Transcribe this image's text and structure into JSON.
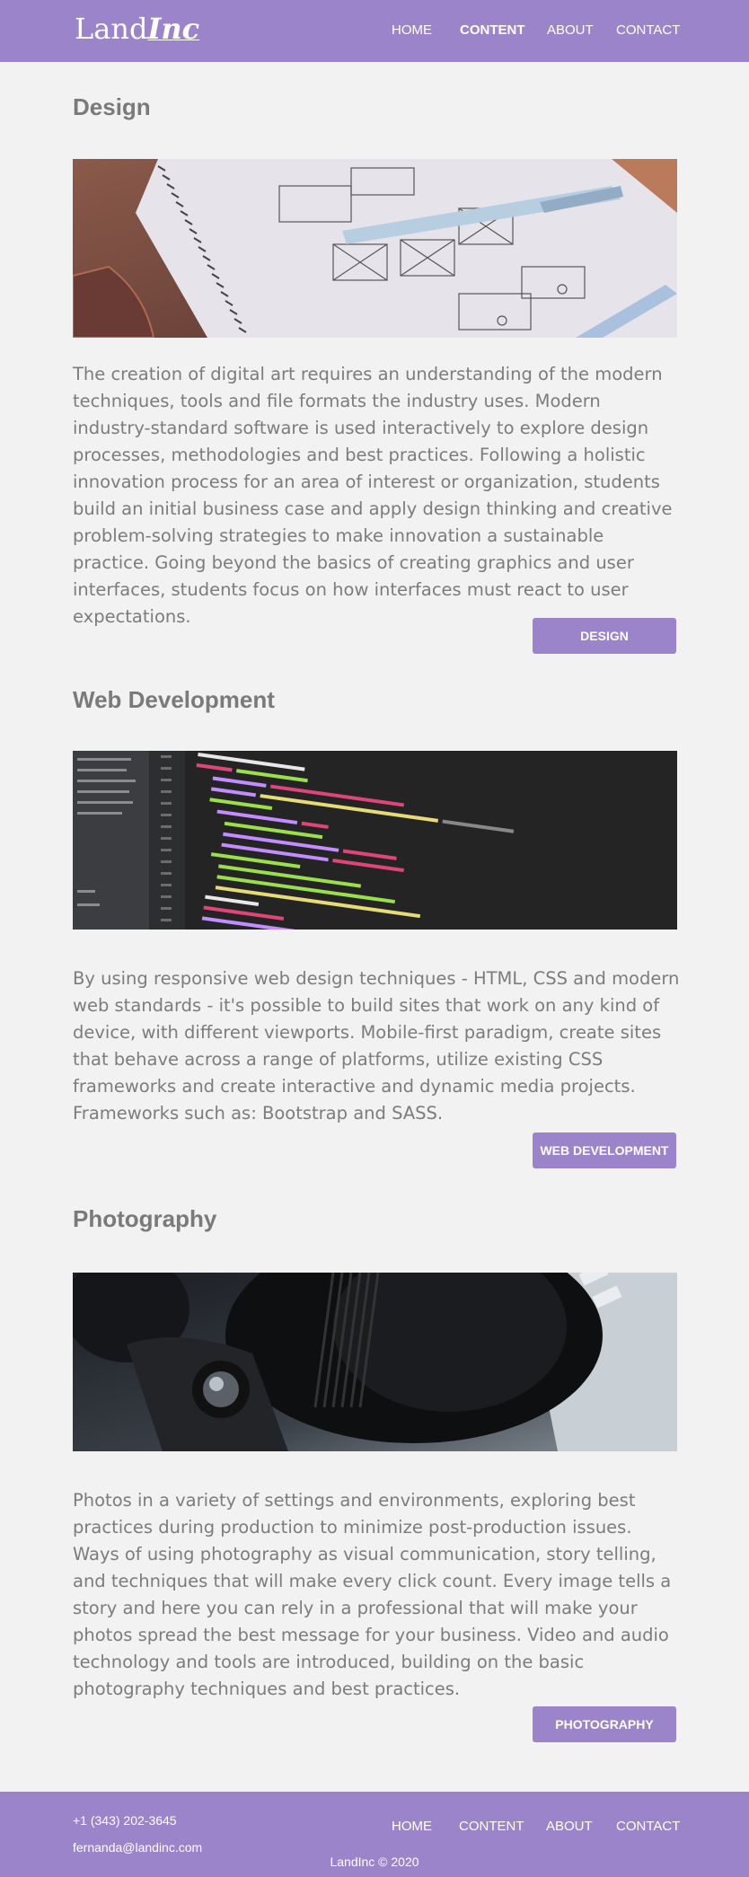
{
  "brand": {
    "name": "Land",
    "suffix": "Inc"
  },
  "nav": [
    {
      "label": "HOME"
    },
    {
      "label": "CONTENT"
    },
    {
      "label": "ABOUT"
    },
    {
      "label": "CONTACT"
    }
  ],
  "sections": [
    {
      "title": "Design",
      "text": "The creation of digital art requires an understanding of the modern techniques, tools and file formats the industry uses. Modern industry-standard software is used interactively to explore design processes, methodologies and best practices. Following a holistic innovation process for an area of interest or organization, students build an initial business case and apply design thinking and creative problem-solving strategies to make innovation a sustainable practice. Going beyond the basics of creating graphics and user interfaces, students focus on how interfaces must react to user expectations.",
      "button": "DESIGN"
    },
    {
      "title": "Web Development",
      "text": "By using responsive web design techniques - HTML, CSS and modern web standards - it's possible to build sites that work on any kind of device, with different viewports. Mobile-first paradigm, create sites that behave across a range of platforms, utilize existing CSS frameworks and create interactive and dynamic media projects. Frameworks such as: Bootstrap and SASS.",
      "button": "WEB DEVELOPMENT"
    },
    {
      "title": "Photography",
      "text": "Photos in a variety of settings and environments, exploring best practices during production to minimize post-production issues. Ways of using photography as visual communication, story telling, and techniques that will make every click count. Every image tells a story and here you can rely in a professional that will make your photos spread the best message for your business. Video and audio technology and tools are introduced, building on the basic photography techniques and best practices.",
      "button": "PHOTOGRAPHY"
    }
  ],
  "footer": {
    "phone": "+1 (343) 202-3645",
    "email": "fernanda@landinc.com",
    "copyright": "LandInc © 2020",
    "nav": [
      {
        "label": "HOME"
      },
      {
        "label": "CONTENT"
      },
      {
        "label": "ABOUT"
      },
      {
        "label": "CONTACT"
      }
    ]
  },
  "colors": {
    "brand": "#9c84cb",
    "background": "#f2f2f2",
    "text": "#7c7c7c"
  }
}
